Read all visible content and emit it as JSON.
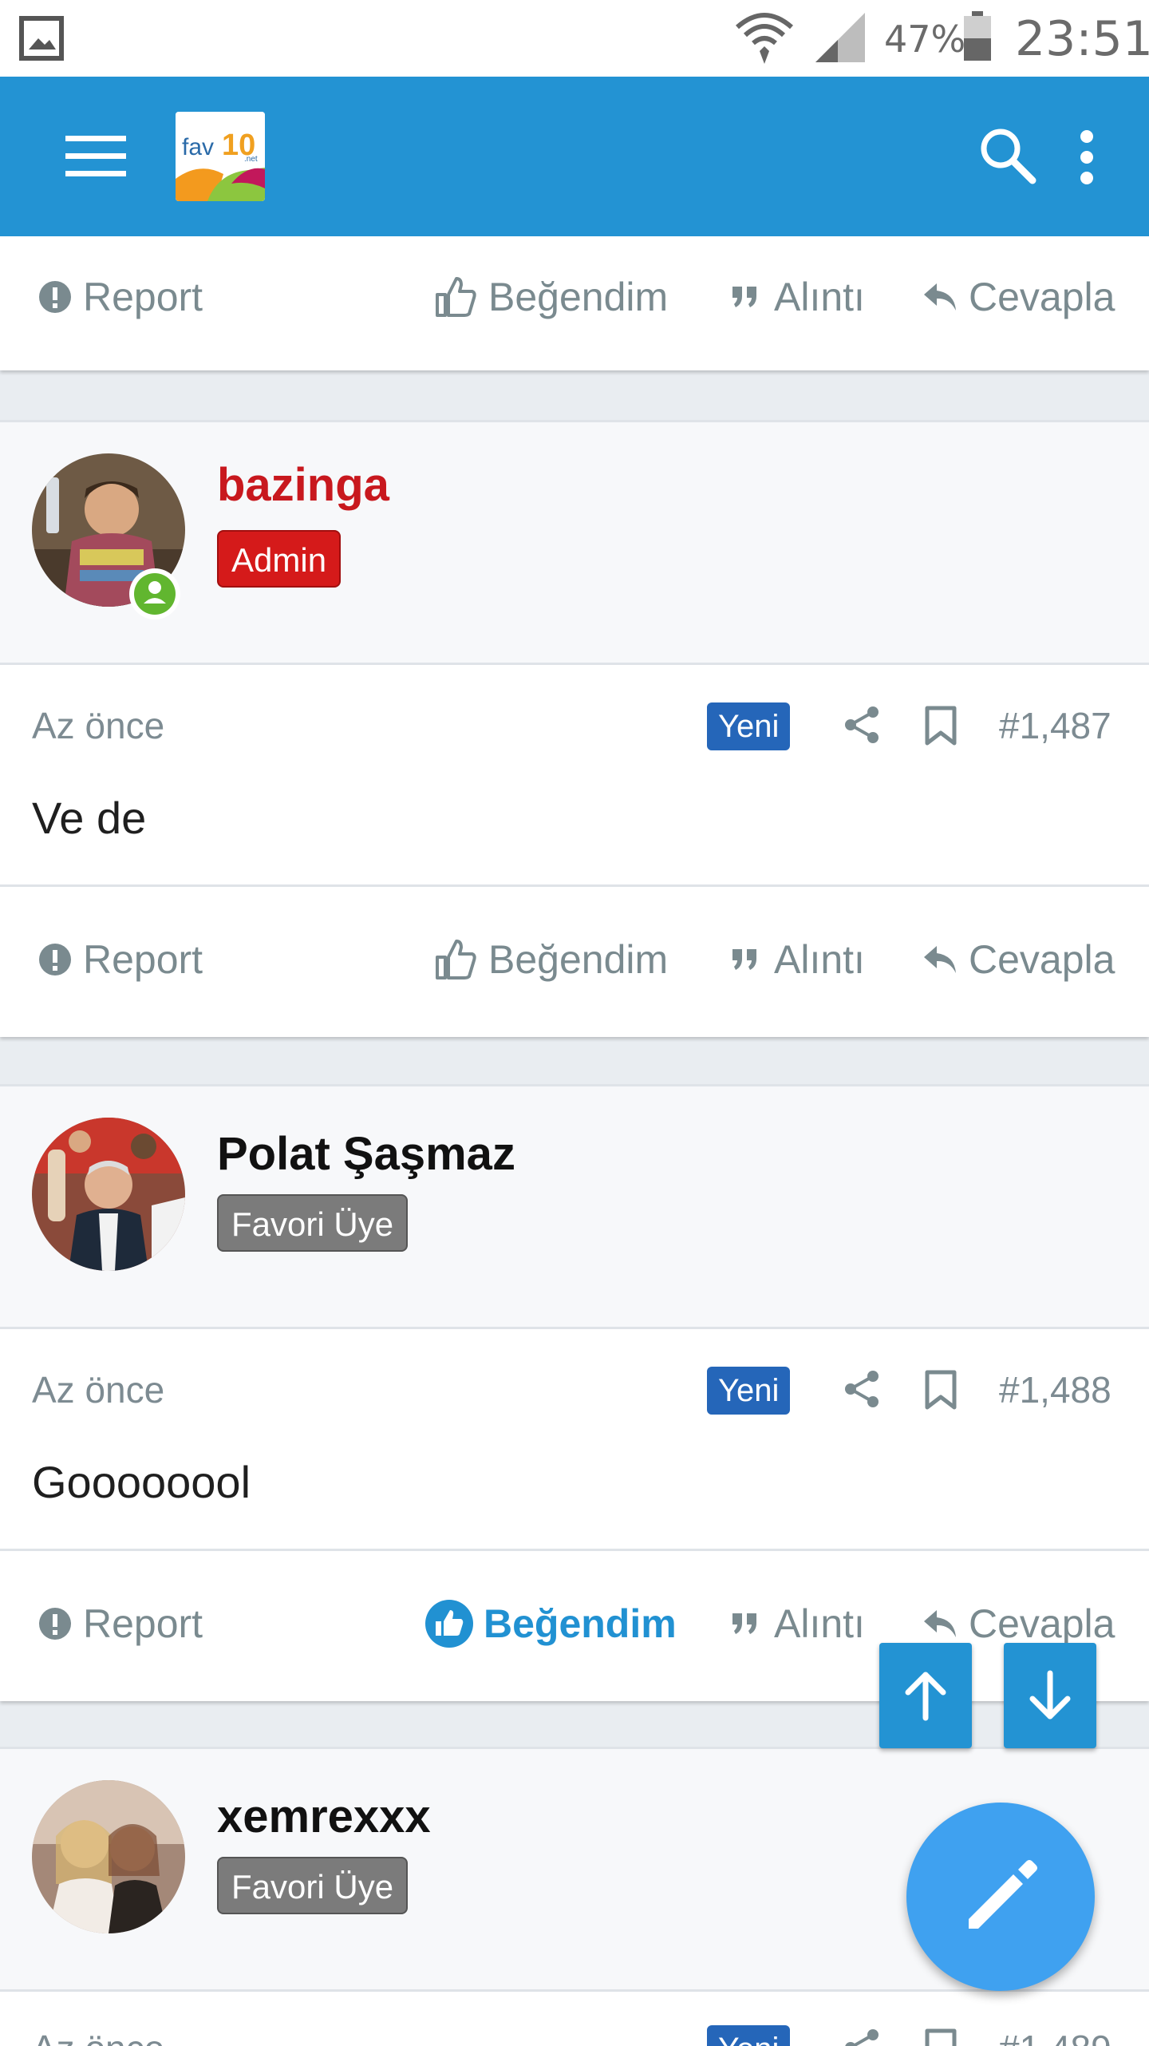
{
  "status_bar": {
    "battery": "47%",
    "time": "23:51"
  },
  "actions": {
    "report": "Report",
    "like": "Beğendim",
    "quote": "Alıntı",
    "reply": "Cevapla"
  },
  "posts": [
    {
      "username": "bazinga",
      "username_color": "#c8181e",
      "badge": "Admin",
      "time": "Az önce",
      "new_label": "Yeni",
      "number": "#1,487",
      "text": "Ve de",
      "online": true
    },
    {
      "username": "Polat Şaşmaz",
      "username_color": "#111111",
      "badge": "Favori Üye",
      "time": "Az önce",
      "new_label": "Yeni",
      "number": "#1,488",
      "text": "Goooooool",
      "liked": true
    },
    {
      "username": "xemrexxx",
      "username_color": "#111111",
      "badge": "Favori Üye",
      "time": "Az önce",
      "new_label": "Yeni",
      "number": "#1,489"
    }
  ],
  "icons": {
    "menu": "hamburger-icon",
    "search": "search-icon",
    "more": "more-vert-icon",
    "report": "alert-circle-icon",
    "like": "thumbs-up-icon",
    "quote": "quote-icon",
    "reply": "reply-icon",
    "share": "share-icon",
    "bookmark": "bookmark-icon",
    "up": "arrow-up-icon",
    "down": "arrow-down-icon",
    "edit": "pencil-icon"
  },
  "colors": {
    "app_bar": "#2393d3",
    "accent": "#2191d2",
    "fab": "#3fa1f0",
    "badge_new": "#2566b9"
  }
}
